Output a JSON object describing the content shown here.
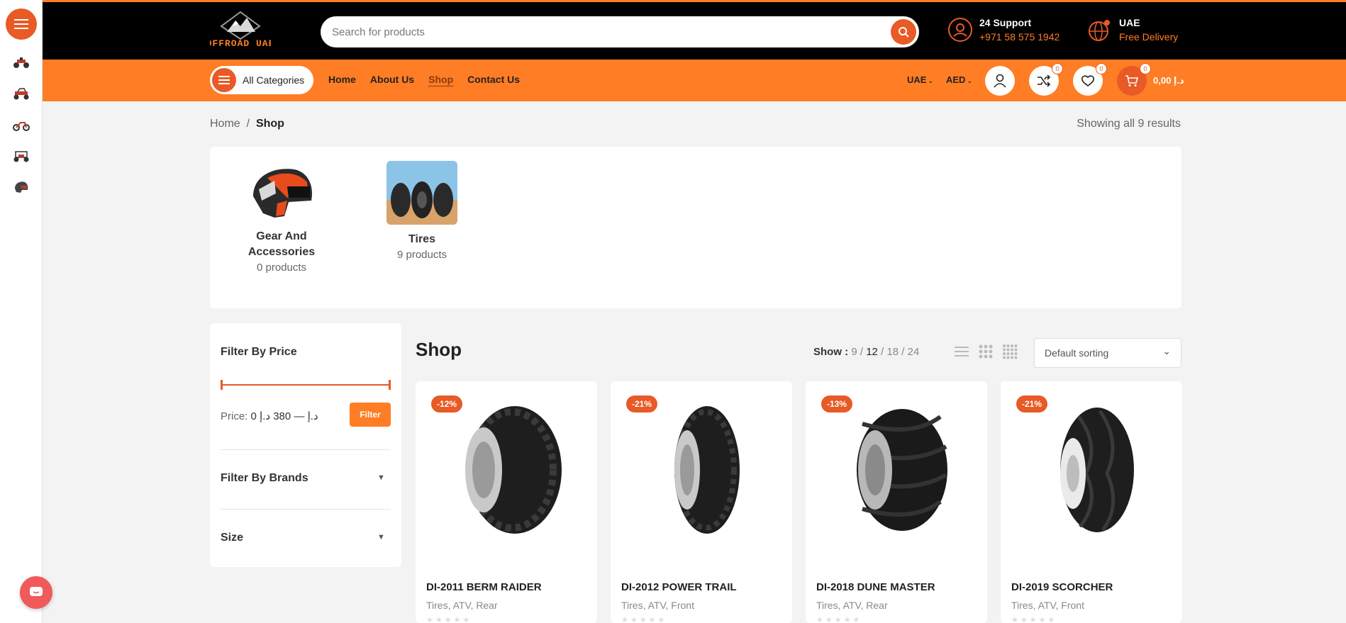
{
  "brand": {
    "logo_text": "OFFROAD UAE"
  },
  "search": {
    "placeholder": "Search for products"
  },
  "support": {
    "title": "24 Support",
    "phone": "+971 58 575 1942"
  },
  "delivery": {
    "title": "UAE",
    "subtitle": "Free Delivery"
  },
  "nav": {
    "all_categories": "All Categories",
    "links": [
      "Home",
      "About Us",
      "Shop",
      "Contact Us"
    ],
    "active": "Shop",
    "country": "UAE",
    "currency": "AED",
    "compare_count": "0",
    "wishlist_count": "0",
    "cart_count": "0",
    "cart_total": "0,00 د.إ"
  },
  "breadcrumb": {
    "home": "Home",
    "current": "Shop"
  },
  "results_text": "Showing all 9 results",
  "categories": [
    {
      "name_line1": "Gear And",
      "name_line2": "Accessories",
      "count": "0 products"
    },
    {
      "name": "Tires",
      "count": "9 products"
    }
  ],
  "filters": {
    "price_title": "Filter By Price",
    "price_label": "Price:",
    "price_range": "0 د.إ — 380 د.إ",
    "filter_button": "Filter",
    "brands_title": "Filter By Brands",
    "size_title": "Size"
  },
  "shop": {
    "title": "Shop",
    "show_label": "Show :",
    "per_page": [
      "9",
      "12",
      "18",
      "24"
    ],
    "per_page_current": "12",
    "sorting": "Default sorting"
  },
  "products": [
    {
      "name": "DI-2011 BERM RAIDER",
      "cats": "Tires, ATV, Rear",
      "discount": "-12%"
    },
    {
      "name": "DI-2012 POWER TRAIL",
      "cats": "Tires, ATV, Front",
      "discount": "-21%"
    },
    {
      "name": "DI-2018 DUNE MASTER",
      "cats": "Tires, ATV, Rear",
      "discount": "-13%"
    },
    {
      "name": "DI-2019 SCORCHER",
      "cats": "Tires, ATV, Front",
      "discount": "-21%"
    }
  ],
  "colors": {
    "accent": "#ff7d24",
    "accent_dark": "#e85a26",
    "header_bg": "#000000"
  }
}
